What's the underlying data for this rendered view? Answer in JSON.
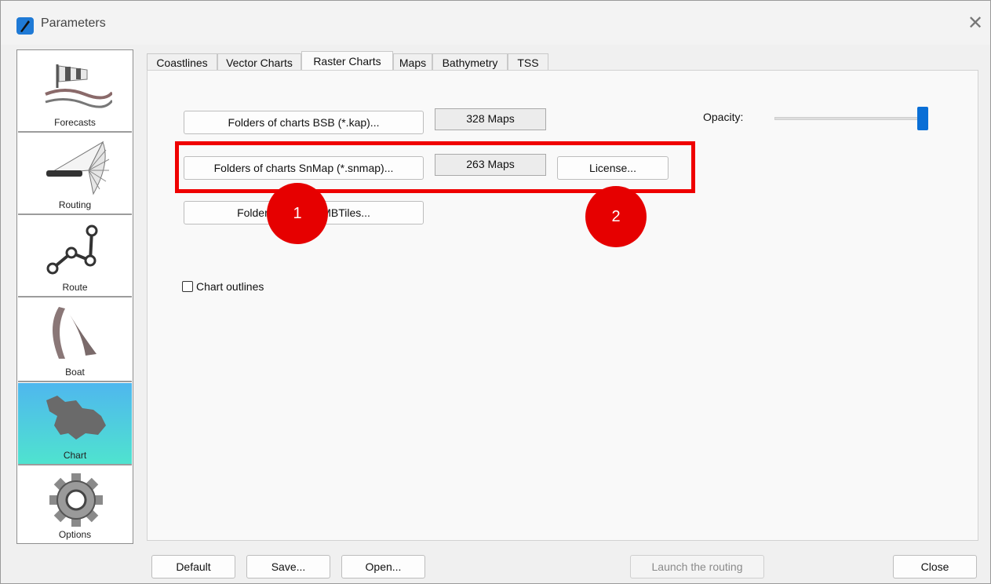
{
  "window": {
    "title": "Parameters",
    "close_symbol": "✕"
  },
  "sidebar": {
    "items": [
      {
        "label": "Forecasts",
        "icon": "windsock-icon"
      },
      {
        "label": "Routing",
        "icon": "routing-fan-icon"
      },
      {
        "label": "Route",
        "icon": "route-nodes-icon"
      },
      {
        "label": "Boat",
        "icon": "sails-icon"
      },
      {
        "label": "Chart",
        "icon": "chart-map-icon",
        "active": true
      },
      {
        "label": "Options",
        "icon": "gear-icon"
      }
    ]
  },
  "tabs": [
    {
      "label": "Coastlines"
    },
    {
      "label": "Vector Charts"
    },
    {
      "label": "Raster Charts",
      "active": true
    },
    {
      "label": "Maps"
    },
    {
      "label": "Bathymetry"
    },
    {
      "label": "TSS"
    }
  ],
  "raster": {
    "bsb_button": "Folders of charts BSB (*.kap)...",
    "bsb_count": "328 Maps",
    "snmap_button": "Folders of charts SnMap (*.snmap)...",
    "snmap_count": "263 Maps",
    "license_button": "License...",
    "mbtiles_button": "Folders of charts MBTiles...",
    "opacity_label": "Opacity:",
    "opacity_value": 1.0,
    "chart_outlines_label": "Chart outlines",
    "chart_outlines_checked": false
  },
  "annotations": {
    "marker1": "1",
    "marker2": "2",
    "color": "#e60000"
  },
  "footer": {
    "default": "Default",
    "save": "Save...",
    "open": "Open...",
    "launch": "Launch the routing",
    "close": "Close"
  }
}
